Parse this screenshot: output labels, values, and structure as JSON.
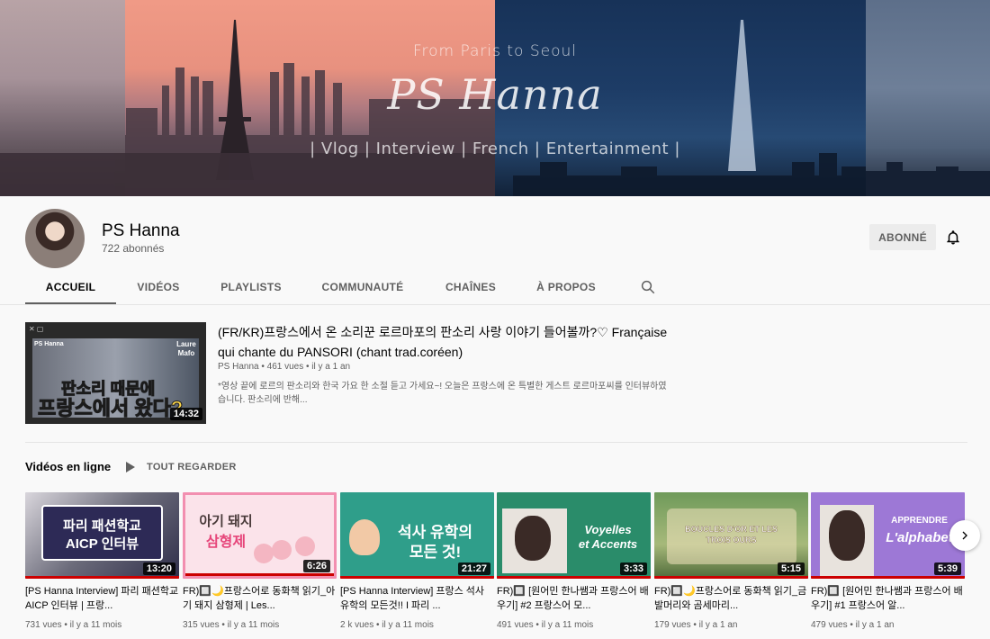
{
  "banner": {
    "tagline": "From Paris to Seoul",
    "title": "PS Hanna",
    "subtitle": "| Vlog | Interview | French | Entertainment |"
  },
  "channel": {
    "name": "PS Hanna",
    "subscribers": "722 abonnés",
    "subscribe_label": "ABONNÉ"
  },
  "tabs": [
    {
      "label": "ACCUEIL",
      "active": true
    },
    {
      "label": "VIDÉOS",
      "active": false
    },
    {
      "label": "PLAYLISTS",
      "active": false
    },
    {
      "label": "COMMUNAUTÉ",
      "active": false
    },
    {
      "label": "CHAÎNES",
      "active": false
    },
    {
      "label": "À PROPOS",
      "active": false
    }
  ],
  "featured": {
    "title": "(FR/KR)프랑스에서 온 소리꾼 로르마포의 판소리 사랑 이야기 들어볼까?♡ Française qui chante du PANSORI (chant trad.coréen)",
    "meta": "PS Hanna • 461 vues • il y a 1 an",
    "description": "*영상 끝에 로르의 판소리와 한국 가요 한 소절 듣고 가세요~! 오늘은 프랑스에 온 특별한 게스트 로르마포씨를 인터뷰하였습니다. 판소리에 반해...",
    "duration": "14:32",
    "thumb_top_left": "PS Hanna",
    "thumb_name": "Laure Mafo",
    "thumb_line1": "판소리 때문에",
    "thumb_line2": "프랑스에서 왔다?"
  },
  "shelf": {
    "title": "Vidéos en ligne",
    "play_all": "TOUT REGARDER",
    "videos": [
      {
        "title": "[PS Hanna Interview] 파리 패션학교 AICP 인터뷰 | 프랑...",
        "meta": "731 vues • il y a 11 mois",
        "duration": "13:20",
        "thumb_line1": "파리 패션학교",
        "thumb_line2": "AICP 인터뷰"
      },
      {
        "title": "FR)🔲🌙프랑스어로 동화책 읽기_아기 돼지 삼형제 | Les...",
        "meta": "315 vues • il y a 11 mois",
        "duration": "6:26",
        "thumb_line1": "아기 돼지",
        "thumb_line2": "삼형제"
      },
      {
        "title": "[PS Hanna Interview] 프랑스 석사 유학의 모든것!! I 파리 ...",
        "meta": "2 k vues • il y a 11 mois",
        "duration": "21:27",
        "thumb_line1": "석사 유학의",
        "thumb_line2": "모든 것!"
      },
      {
        "title": "FR)🔲 [원어민 한나쌤과 프랑스어 배우기] #2 프랑스어 모...",
        "meta": "491 vues • il y a 11 mois",
        "duration": "3:33",
        "thumb_line1": "Voyelles",
        "thumb_line2": "et Accents"
      },
      {
        "title": "FR)🔲🌙프랑스어로 동화책 읽기_금발머리와 곰세마리...",
        "meta": "179 vues • il y a 1 an",
        "duration": "5:15",
        "thumb_line1": "BOUCLES D'OR ET LES",
        "thumb_line2": "TROIS OURS"
      },
      {
        "title": "FR)🔲 [원어민 한나쌤과 프랑스어 배우기] #1 프랑스어 알...",
        "meta": "479 vues • il y a 1 an",
        "duration": "5:39",
        "thumb_line1": "APPRENDRE",
        "thumb_line2": "L'alphabet"
      }
    ]
  }
}
